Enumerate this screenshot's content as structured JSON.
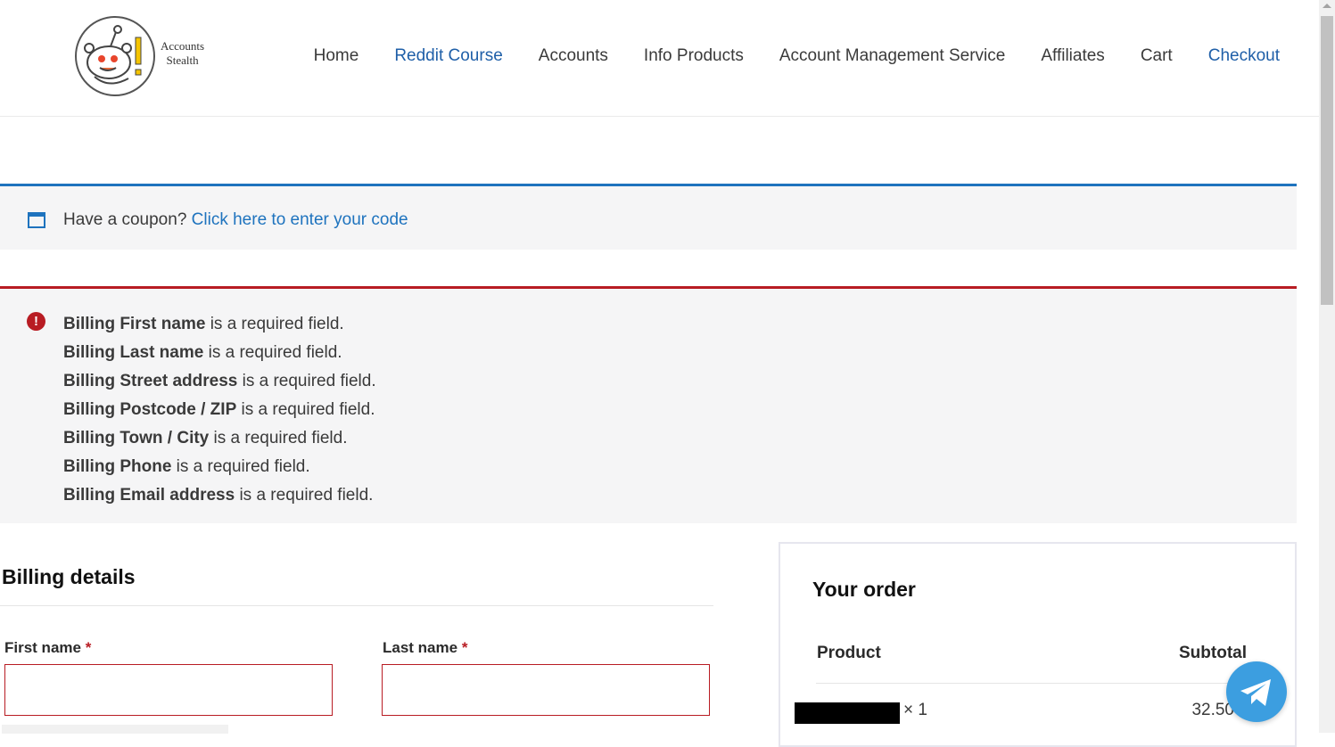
{
  "header": {
    "logo_text_line1": "Accounts",
    "logo_text_line2": "Stealth",
    "nav": [
      {
        "label": "Home"
      },
      {
        "label": "Reddit Course"
      },
      {
        "label": "Accounts"
      },
      {
        "label": "Info Products"
      },
      {
        "label": "Account Management Service"
      },
      {
        "label": "Affiliates"
      },
      {
        "label": "Cart"
      },
      {
        "label": "Checkout"
      }
    ]
  },
  "coupon": {
    "prompt": "Have a coupon?",
    "link": "Click here to enter your code"
  },
  "errors": [
    {
      "field": "Billing First name",
      "msg": "is a required field."
    },
    {
      "field": "Billing Last name",
      "msg": "is a required field."
    },
    {
      "field": "Billing Street address",
      "msg": "is a required field."
    },
    {
      "field": "Billing Postcode / ZIP",
      "msg": "is a required field."
    },
    {
      "field": "Billing Town / City",
      "msg": "is a required field."
    },
    {
      "field": "Billing Phone",
      "msg": "is a required field."
    },
    {
      "field": "Billing Email address",
      "msg": "is a required field."
    }
  ],
  "billing": {
    "title": "Billing details",
    "first_name_label": "First name",
    "last_name_label": "Last name",
    "required_mark": "*",
    "first_name_value": "",
    "last_name_value": ""
  },
  "order": {
    "title": "Your order",
    "col_product": "Product",
    "col_subtotal": "Subtotal",
    "item_qty": "× 1",
    "item_price": "32.50"
  },
  "colors": {
    "accent": "#1e73be",
    "error": "#b81c23",
    "telegram": "#3c9ee0"
  },
  "icons": [
    "coupon-window-icon",
    "error-exclamation-icon",
    "telegram-plane-icon",
    "reddit-alien-logo"
  ]
}
